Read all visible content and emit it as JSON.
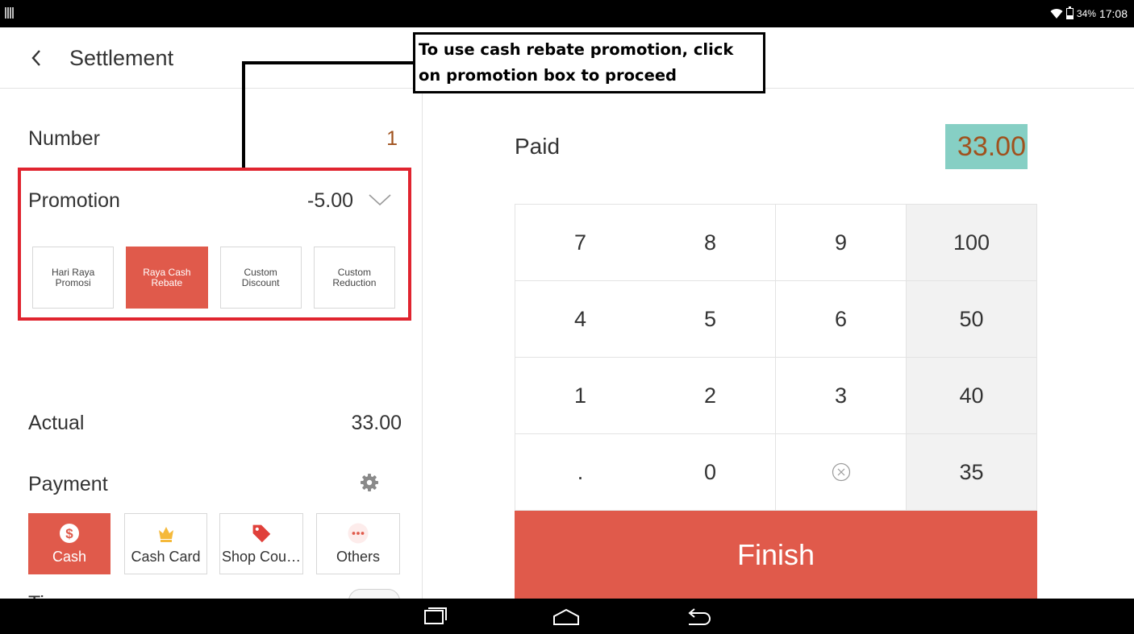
{
  "status_bar": {
    "battery": "34%",
    "time": "17:08"
  },
  "header": {
    "title": "Settlement"
  },
  "summary": {
    "number_label": "Number",
    "number_value": "1",
    "promotion_label": "Promotion",
    "promotion_value": "-5.00",
    "actual_label": "Actual",
    "actual_value": "33.00",
    "payment_label": "Payment"
  },
  "promotions": [
    {
      "label": "Hari Raya Promosi",
      "selected": false
    },
    {
      "label": "Raya Cash Rebate",
      "selected": true
    },
    {
      "label": "Custom Discount",
      "selected": false
    },
    {
      "label": "Custom Reduction",
      "selected": false
    }
  ],
  "payment_methods": [
    {
      "label": "Cash",
      "icon": "dollar-icon",
      "selected": true
    },
    {
      "label": "Cash Card",
      "icon": "crown-icon",
      "selected": false
    },
    {
      "label": "Shop Cou…",
      "icon": "tag-icon",
      "selected": false
    },
    {
      "label": "Others",
      "icon": "more-icon",
      "selected": false
    }
  ],
  "tip_label": "Tip",
  "paid": {
    "label": "Paid",
    "value": "33.00"
  },
  "keypad": {
    "rows": [
      [
        "7",
        "8",
        "9",
        "100"
      ],
      [
        "4",
        "5",
        "6",
        "50"
      ],
      [
        "1",
        "2",
        "3",
        "40"
      ],
      [
        ".",
        "0",
        "",
        "35"
      ]
    ]
  },
  "finish_label": "Finish",
  "annotation": {
    "text": "To use cash rebate promotion, click on promotion box to proceed"
  },
  "colors": {
    "accent": "#e05a4b",
    "value_brown": "#a0521e",
    "paid_highlight": "#86cfc4",
    "annotation_red": "#e0242f"
  }
}
